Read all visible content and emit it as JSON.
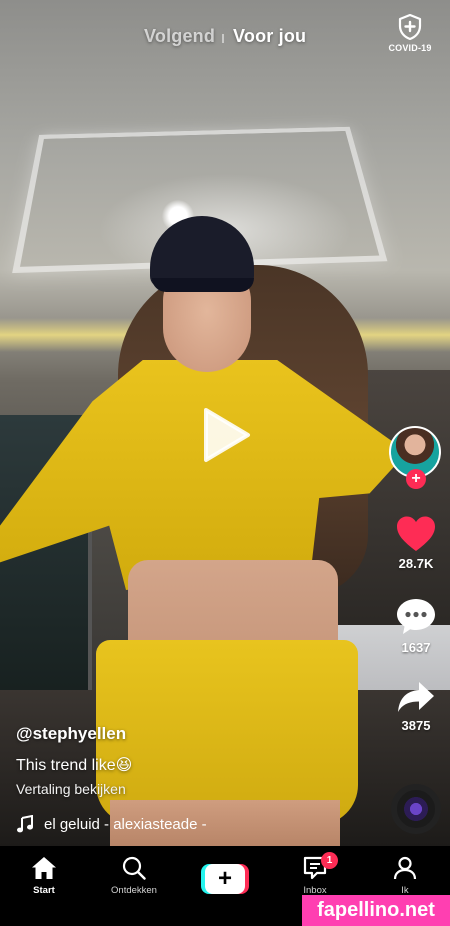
{
  "topbar": {
    "tab_following": "Volgend",
    "tab_for_you": "Voor jou",
    "covid_label": "COVID-19"
  },
  "actions": {
    "likes": "28.7K",
    "comments": "1637",
    "shares": "3875"
  },
  "caption": {
    "username": "@stephyellen",
    "description": "This trend like😆",
    "translate": "Vertaling bekijken",
    "sound": "el geluid - alexiasteade -"
  },
  "bottom_nav": {
    "home": "Start",
    "discover": "Ontdekken",
    "create": "+",
    "inbox": "Inbox",
    "inbox_badge": "1",
    "me": "Ik"
  },
  "watermark": "fapellino.net",
  "colors": {
    "accent_red": "#fe2c55",
    "accent_cyan": "#25f4ee",
    "watermark_pink": "#ff3fb1"
  },
  "icons": [
    "shield-icon",
    "play-icon",
    "heart-icon",
    "comment-icon",
    "share-icon",
    "music-note-icon",
    "home-icon",
    "search-icon",
    "inbox-icon",
    "profile-icon"
  ]
}
